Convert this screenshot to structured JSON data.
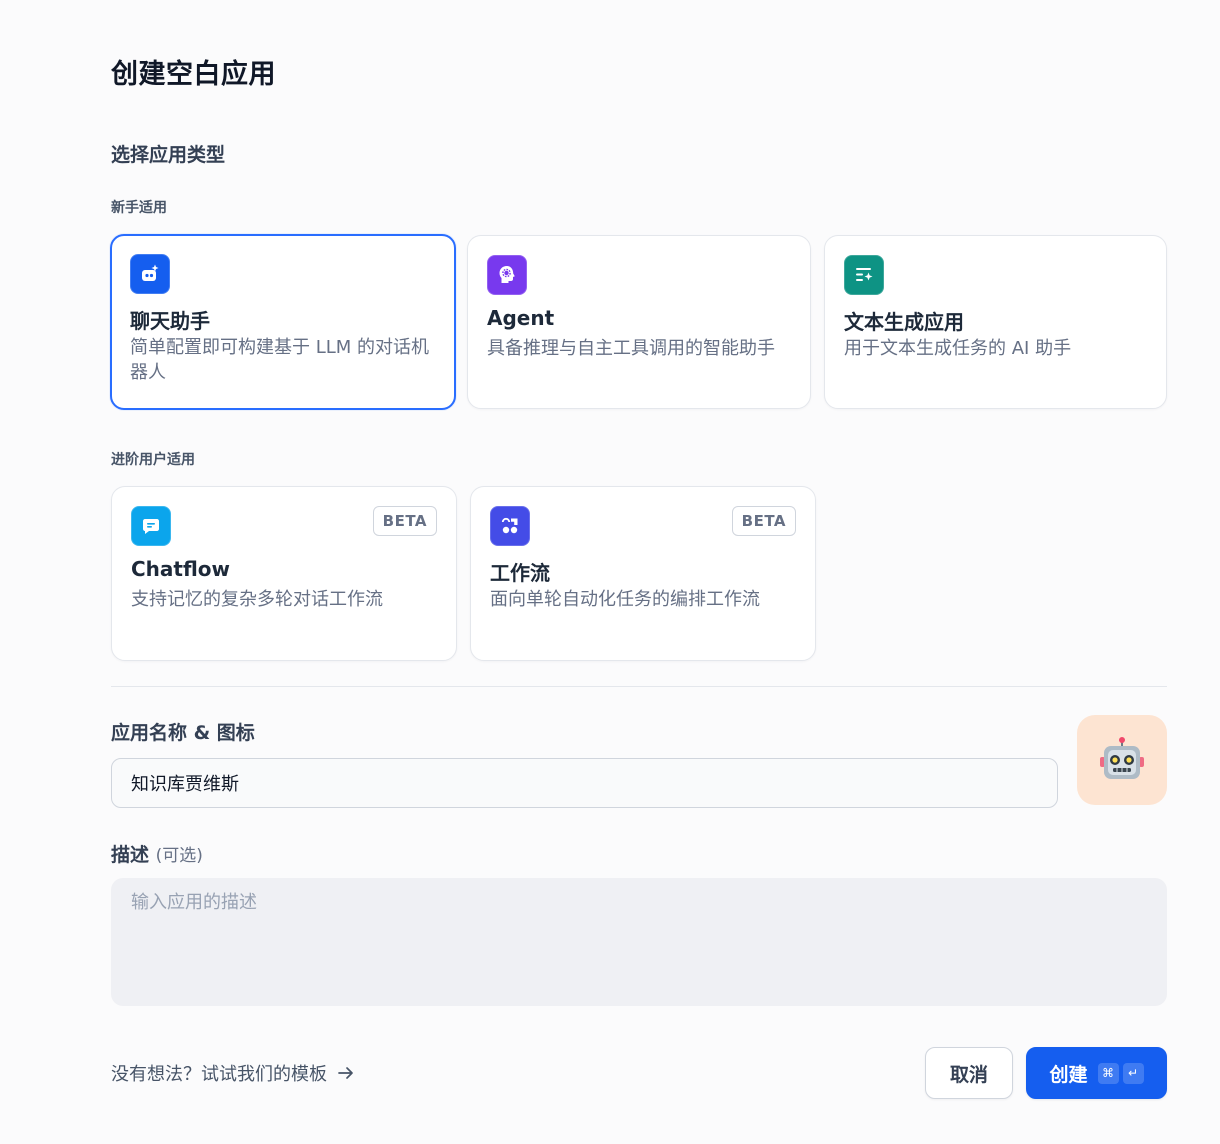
{
  "page": {
    "title": "创建空白应用",
    "section_title": "选择应用类型"
  },
  "groups": {
    "beginner": {
      "label": "新手适用",
      "cards": [
        {
          "title": "聊天助手",
          "desc": "简单配置即可构建基于 LLM 的对话机器人",
          "icon": "chat-bot-icon",
          "color": "#155eef",
          "selected": true
        },
        {
          "title": "Agent",
          "desc": "具备推理与自主工具调用的智能助手",
          "icon": "agent-brain-icon",
          "color": "#7839ee"
        },
        {
          "title": "文本生成应用",
          "desc": "用于文本生成任务的 AI 助手",
          "icon": "text-generation-icon",
          "color": "#0e9384"
        }
      ]
    },
    "advanced": {
      "label": "进阶用户适用",
      "cards": [
        {
          "title": "Chatflow",
          "desc": "支持记忆的复杂多轮对话工作流",
          "badge": "BETA",
          "icon": "chatflow-icon",
          "color": "#0ba5ec"
        },
        {
          "title": "工作流",
          "desc": "面向单轮自动化任务的编排工作流",
          "badge": "BETA",
          "icon": "workflow-icon",
          "color": "#444ce7"
        }
      ]
    }
  },
  "form": {
    "name_label": "应用名称 & 图标",
    "name_value": "知识库贾维斯",
    "app_icon": "robot-emoji-icon",
    "app_icon_glyph": "🤖",
    "app_icon_background": "#fde4d2",
    "desc_label": "描述",
    "desc_optional": "(可选)",
    "desc_placeholder": "输入应用的描述"
  },
  "footer": {
    "template_link": "没有想法？试试我们的模板",
    "cancel_label": "取消",
    "create_label": "创建",
    "shortcut_cmd": "⌘",
    "shortcut_enter": "↵"
  },
  "colors": {
    "primary": "#155eef",
    "selected_border": "#296dff"
  }
}
